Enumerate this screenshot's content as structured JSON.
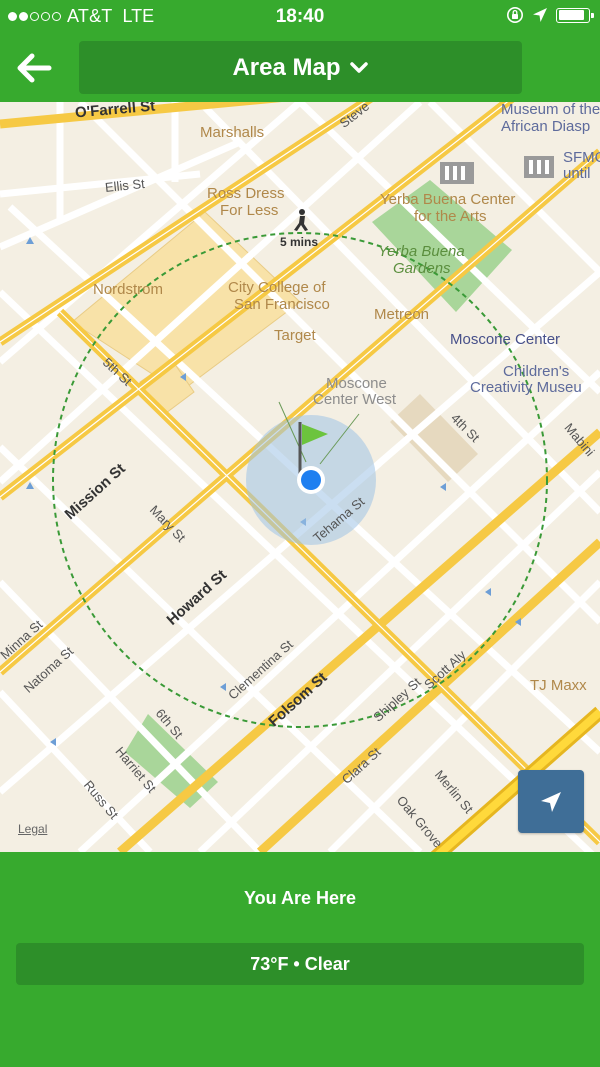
{
  "status_bar": {
    "carrier": "AT&T",
    "network": "LTE",
    "time": "18:40",
    "signal_bars_filled": 2,
    "signal_bars_total": 5,
    "battery_level": 0.9
  },
  "header": {
    "title": "Area Map",
    "back_icon": "arrow-left-icon",
    "dropdown_icon": "chevron-down-icon"
  },
  "map": {
    "walk_time": "5 mins",
    "legal": "Legal",
    "pois": {
      "marshalls": "Marshalls",
      "ross_line1": "Ross Dress",
      "ross_line2": "For Less",
      "nordstrom": "Nordstrom",
      "city_college_line1": "City College of",
      "city_college_line2": "San Francisco",
      "target": "Target",
      "yerba_center_line1": "Yerba Buena Center",
      "yerba_center_line2": "for the Arts",
      "yerba_gardens_line1": "Yerba Buena",
      "yerba_gardens_line2": "Gardens",
      "metreon": "Metreon",
      "moscone_center": "Moscone Center",
      "moscone_west_line1": "Moscone",
      "moscone_west_line2": "Center West",
      "museum_line1": "Museum of the",
      "museum_line2": "African Diasp",
      "sfmoma_line1": "SFMO",
      "sfmoma_line2": "until",
      "childrens_line1": "Children's",
      "childrens_line2": "Creativity Museu",
      "tj_maxx": "TJ Maxx"
    },
    "streets": {
      "ofarrell": "O'Farrell St",
      "ellis": "Ellis St",
      "steve": "Steve",
      "fifth": "5th St",
      "mission": "Mission St",
      "mary": "Mary St",
      "howard": "Howard St",
      "tehama": "Tehama St",
      "fourth": "4th St",
      "mabini": "Mabini",
      "minna": "Minna St",
      "natoma": "Natoma St",
      "clementina": "Clementina St",
      "folsom": "Folsom St",
      "shipley": "Shipley St",
      "scott_aly": "Scott Aly",
      "sixth": "6th St",
      "harriet": "Harriet St",
      "russ": "Russ St",
      "clara": "Clara St",
      "merlin": "Merlin St",
      "oak_grove": "Oak Grove"
    },
    "colors": {
      "land": "#f4efe3",
      "major_road": "#f6c944",
      "minor_road": "#ffffff",
      "park": "#a9d69a",
      "building": "#f8e2a8",
      "radius_circle": "#3a9a37",
      "location_dot": "#1f7ff0",
      "flag": "#6cc43d",
      "locate_button": "#3f6e97"
    }
  },
  "panel": {
    "location_label": "You Are Here",
    "weather": "73°F • Clear"
  },
  "icons": {
    "locate": "location-arrow-icon",
    "walk": "pedestrian-icon",
    "flag": "flag-icon",
    "building": "building-icon"
  }
}
